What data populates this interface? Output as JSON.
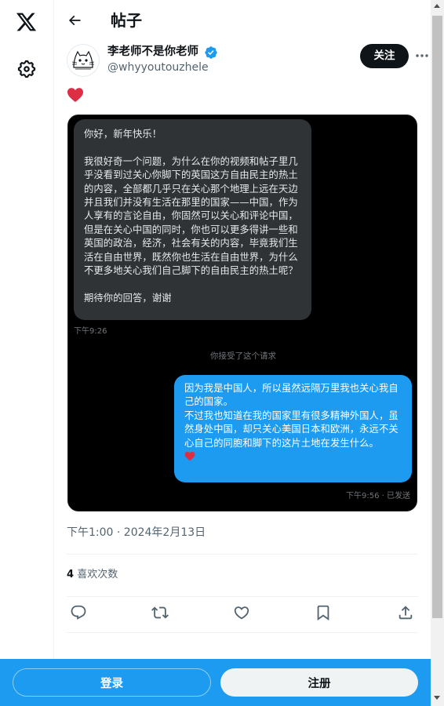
{
  "header": {
    "title": "帖子"
  },
  "author": {
    "name": "李老师不是你老师",
    "handle": "@whyyoutouzhele",
    "follow_label": "关注"
  },
  "screenshot": {
    "left_message": {
      "greeting": "你好，新年快乐！",
      "body": "我很好奇一个问题，为什么在你的视频和帖子里几乎没看到过关心你脚下的英国这方自由民主的热土的内容，全部都几乎只在关心那个地理上远在天边并且我们并没有生活在那里的国家——中国，作为人享有的言论自由，你固然可以关心和评论中国，但是在关心中国的同时，你也可以更多得讲一些和英国的政治，经济，社会有关的内容，毕竟我们生活在自由世界，既然你也生活在自由世界，为什么不更多地关心我们自己脚下的自由民主的热土呢？",
      "closing": "期待你的回答，谢谢",
      "time": "下午9:26"
    },
    "system_notice": "你接受了这个请求",
    "right_message": {
      "line1": "因为我是中国人，所以虽然远隔万里我也关心我自己的国家。",
      "line2": "不过我也知道在我的国家里有很多精神外国人，虽然身处中国，却只关心美国日本和欧洲，永远不关心自己的同胞和脚下的这片土地在发生什么。",
      "time": "下午9:56 · 已发送"
    }
  },
  "post_meta": {
    "timestamp": "下午1:00 · 2024年2月13日"
  },
  "stats": {
    "likes_count": "4",
    "likes_label": "喜欢次数"
  },
  "bottom_bar": {
    "login_label": "登录",
    "signup_label": "注册"
  },
  "colors": {
    "accent": "#1d9bf0",
    "heart": "#f91880",
    "text": "#0f1419",
    "secondary": "#536471"
  },
  "icons": [
    "x-logo-icon",
    "settings-icon",
    "back-arrow-icon",
    "verified-badge-icon",
    "more-icon",
    "heart-emoji-icon",
    "reply-icon",
    "repost-icon",
    "like-icon",
    "bookmark-icon",
    "share-icon"
  ]
}
